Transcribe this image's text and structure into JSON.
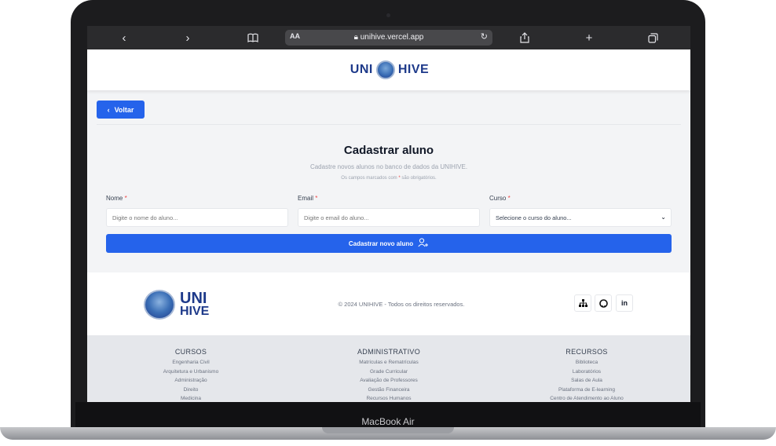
{
  "browser": {
    "url": "unihive.vercel.app",
    "text_size_label": "AA"
  },
  "header": {
    "logo_left": "UNI",
    "logo_right": "HIVE"
  },
  "actions": {
    "back_label": "Voltar",
    "submit_label": "Cadastrar novo aluno"
  },
  "form": {
    "title": "Cadastrar aluno",
    "subtitle": "Cadastre novos alunos no banco de dados da UNIHIVE.",
    "note_before": "Os campos marcados com ",
    "note_mark": "*",
    "note_after": " são obrigatórios.",
    "fields": [
      {
        "label": "Nome",
        "placeholder": "Digite o nome do aluno..."
      },
      {
        "label": "Email",
        "placeholder": "Digite o email do aluno..."
      },
      {
        "label": "Curso",
        "placeholder": "Selecione o curso do aluno..."
      }
    ],
    "required_mark": "*"
  },
  "footer": {
    "logo_top": "UNI",
    "logo_bottom": "HIVE",
    "copyright": "© 2024 UNIHIVE - Todos os direitos reservados.",
    "social": [
      "sitemap-icon",
      "github-icon",
      "linkedin-icon"
    ],
    "linkedin_text": "in",
    "columns": [
      {
        "title": "CURSOS",
        "items": [
          "Engenharia Civil",
          "Arquitetura e Urbanismo",
          "Administração",
          "Direito",
          "Medicina"
        ]
      },
      {
        "title": "ADMINISTRATIVO",
        "items": [
          "Matrículas e Rematrículas",
          "Grade Curricular",
          "Avaliação de Professores",
          "Gestão Financeira",
          "Recursos Humanos"
        ]
      },
      {
        "title": "RECURSOS",
        "items": [
          "Biblioteca",
          "Laboratórios",
          "Salas de Aula",
          "Plataforma de E-learning",
          "Centro de Atendimento ao Aluno"
        ]
      }
    ]
  },
  "device": {
    "model": "MacBook Air"
  },
  "colors": {
    "primary": "#2563eb",
    "brand": "#1e3a8a",
    "required": "#ef4444"
  }
}
